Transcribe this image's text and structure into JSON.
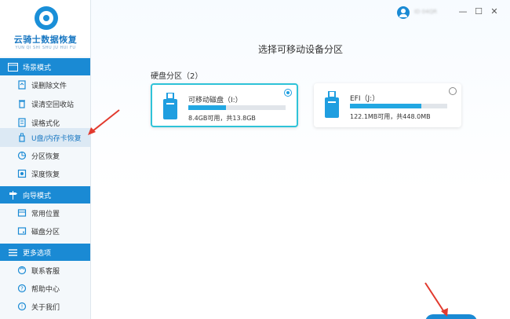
{
  "app": {
    "title": "云骑士数据恢复",
    "subtitle": "YUN QI SHI SHU JU HUI FU",
    "user_name": "ID 04QR"
  },
  "sidebar": {
    "sections": [
      {
        "label": "场景模式",
        "icon": "window-icon",
        "items": [
          {
            "label": "误删除文件",
            "icon": "recycle-file-icon"
          },
          {
            "label": "误清空回收站",
            "icon": "trash-icon"
          },
          {
            "label": "误格式化",
            "icon": "format-icon"
          },
          {
            "label": "U盘/内存卡恢复",
            "icon": "usb-card-icon",
            "active": true
          },
          {
            "label": "分区恢复",
            "icon": "partition-icon"
          },
          {
            "label": "深度恢复",
            "icon": "deep-scan-icon"
          }
        ]
      },
      {
        "label": "向导模式",
        "icon": "signpost-icon",
        "items": [
          {
            "label": "常用位置",
            "icon": "location-icon"
          },
          {
            "label": "磁盘分区",
            "icon": "disk-icon"
          }
        ]
      },
      {
        "label": "更多选项",
        "icon": "menu-icon",
        "items": [
          {
            "label": "联系客服",
            "icon": "headset-icon"
          },
          {
            "label": "帮助中心",
            "icon": "help-icon"
          },
          {
            "label": "关于我们",
            "icon": "info-icon"
          }
        ]
      }
    ]
  },
  "window_controls": {
    "minimize": "—",
    "maximize": "☐",
    "close": "✕"
  },
  "main": {
    "title": "选择可移动设备分区",
    "group_label": "硬盘分区（2）",
    "partitions": [
      {
        "name": "可移动磁盘（I:）",
        "info": "8.4GB可用，共13.8GB",
        "usage": 0.39,
        "selected": true
      },
      {
        "name": "EFI（J:）",
        "info": "122.1MB可用，共448.0MB",
        "usage": 0.73,
        "selected": false
      }
    ]
  },
  "colors": {
    "accent": "#1a8ad4",
    "selected_border": "#2fc3d8",
    "bar_fill": "#22a7e2",
    "annotation": "#e23a2e"
  }
}
